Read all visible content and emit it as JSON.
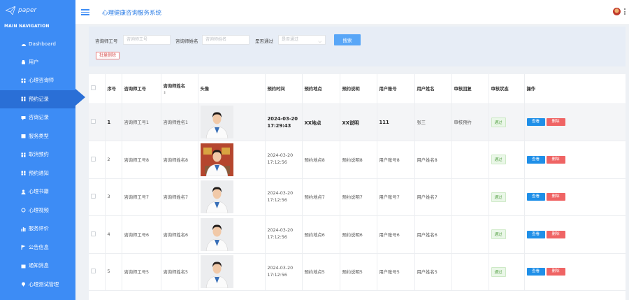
{
  "app": {
    "logo_text": "paper",
    "title": "心理健康咨询服务系统"
  },
  "sidebar": {
    "header": "MAIN NAVIGATION",
    "items": [
      {
        "label": "Dashboard",
        "icon": "dashboard-icon"
      },
      {
        "label": "用户",
        "icon": "user-icon"
      },
      {
        "label": "心理咨询师",
        "icon": "counselor-icon"
      },
      {
        "label": "预约记录",
        "icon": "grid-icon",
        "active": true
      },
      {
        "label": "咨询记录",
        "icon": "chat-icon"
      },
      {
        "label": "服务类型",
        "icon": "category-icon"
      },
      {
        "label": "取消预约",
        "icon": "grid-icon"
      },
      {
        "label": "预约通知",
        "icon": "grid-icon"
      },
      {
        "label": "心理书籍",
        "icon": "person-icon"
      },
      {
        "label": "心理视频",
        "icon": "video-icon"
      },
      {
        "label": "服务评价",
        "icon": "rating-icon"
      },
      {
        "label": "公告信息",
        "icon": "flag-icon"
      },
      {
        "label": "通知消息",
        "icon": "message-icon"
      },
      {
        "label": "心理测试管理",
        "icon": "test-icon"
      }
    ]
  },
  "search": {
    "counselor_no_label": "咨询师工号",
    "counselor_no_placeholder": "咨询师工号",
    "counselor_name_label": "咨询师姓名",
    "counselor_name_placeholder": "咨询师姓名",
    "approved_label": "是否通过",
    "approved_placeholder": "是否通过",
    "search_button": "搜索",
    "batch_delete_button": "批量删除"
  },
  "table": {
    "headers": {
      "index": "序号",
      "counselor_no": "咨询师工号",
      "counselor_name": "咨询师姓名",
      "avatar": "头像",
      "appt_time": "预约时间",
      "appt_place": "预约地点",
      "appt_desc": "预约说明",
      "user_account": "用户账号",
      "user_name": "用户姓名",
      "review_reply": "审核回复",
      "review_status": "审核状态",
      "actions": "操作"
    },
    "view_label": "查看",
    "delete_label": "删除",
    "rows": [
      {
        "index": "1",
        "counselor_no": "咨询师工号1",
        "counselor_name": "咨询师姓名1",
        "time": "2024-03-20 17:29:43",
        "place": "XX地点",
        "desc": "XX说明",
        "account": "111",
        "name": "张三",
        "reply": "审核预约",
        "status": "通过"
      },
      {
        "index": "2",
        "counselor_no": "咨询师工号8",
        "counselor_name": "咨询师姓名8",
        "time": "2024-03-20 17:12:56",
        "place": "预约地点8",
        "desc": "预约说明8",
        "account": "用户账号8",
        "name": "用户姓名8",
        "reply": "",
        "status": "通过"
      },
      {
        "index": "3",
        "counselor_no": "咨询师工号7",
        "counselor_name": "咨询师姓名7",
        "time": "2024-03-20 17:12:56",
        "place": "预约地点7",
        "desc": "预约说明7",
        "account": "用户账号7",
        "name": "用户姓名7",
        "reply": "",
        "status": "通过"
      },
      {
        "index": "4",
        "counselor_no": "咨询师工号6",
        "counselor_name": "咨询师姓名6",
        "time": "2024-03-20 17:12:56",
        "place": "预约地点6",
        "desc": "预约说明6",
        "account": "用户账号6",
        "name": "用户姓名6",
        "reply": "",
        "status": "通过"
      },
      {
        "index": "5",
        "counselor_no": "咨询师工号5",
        "counselor_name": "咨询师姓名5",
        "time": "2024-03-20 17:12:56",
        "place": "预约地点5",
        "desc": "预约说明5",
        "account": "用户账号5",
        "name": "用户姓名5",
        "reply": "",
        "status": "通过"
      }
    ]
  },
  "colors": {
    "sidebar": "#3d8cf5",
    "sidebar_active": "#2a6fd6",
    "view_button": "#1f8fe8",
    "delete_button": "#ef6464",
    "status_pass": "#5aa44a"
  }
}
